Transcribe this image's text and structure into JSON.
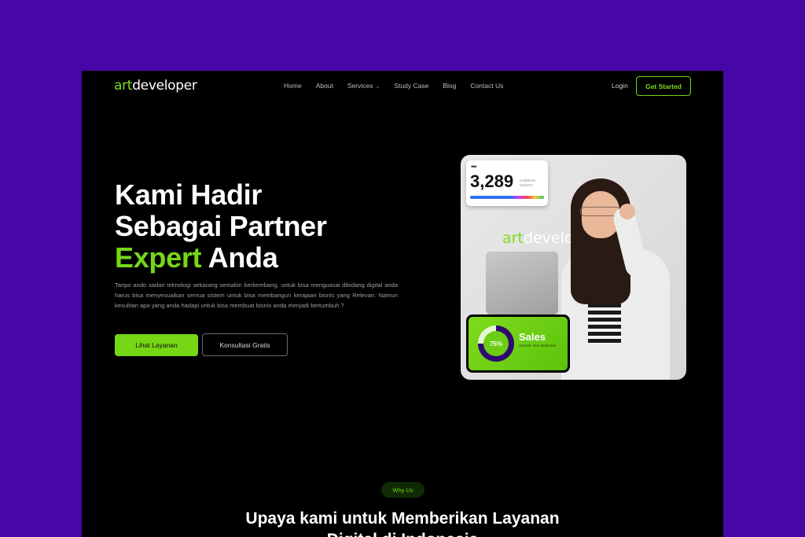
{
  "brand": {
    "logo_art": "art",
    "logo_dev": "developer",
    "accent": "#76d716",
    "outer_bg": "#4706a6"
  },
  "nav": {
    "items": [
      "Home",
      "About",
      "Services",
      "Study Case",
      "Blog",
      "Contact Us"
    ],
    "services_caret": "⌄",
    "login": "Login",
    "cta": "Get Started"
  },
  "hero": {
    "line1": "Kami Hadir",
    "line2": "Sebagai Partner",
    "line3_green": "Expert",
    "line3_white": " Anda",
    "paragraph": "Tanpo ando sadari teknologi sekarang semakin berkembang, untuk bisa menguasai dibidang digital anda harus bisa menyesuaikan semua sistem untuk bisa membangun kerajaan bisnis yang Relevan. Namun kesulitan apa yang anda hadapi untuk bisa membuat bisnis anda menjadi bertumbuh ?",
    "primary_button": "Lihat Layanan",
    "secondary_button": "Konsultasi Gratis"
  },
  "audience_card": {
    "dots": "•••",
    "value": "3,289",
    "label": "Audience Visitor's"
  },
  "photo_logo": {
    "art": "art",
    "dev": "developer"
  },
  "sales_card": {
    "percent": "75%",
    "title": "Sales",
    "subtitle": "Growth Your Business",
    "progress": 0.75
  },
  "why": {
    "badge": "Why Us",
    "title_line1": "Upaya kami untuk Memberikan Layanan",
    "title_line2": "Digital di Indonesia"
  }
}
